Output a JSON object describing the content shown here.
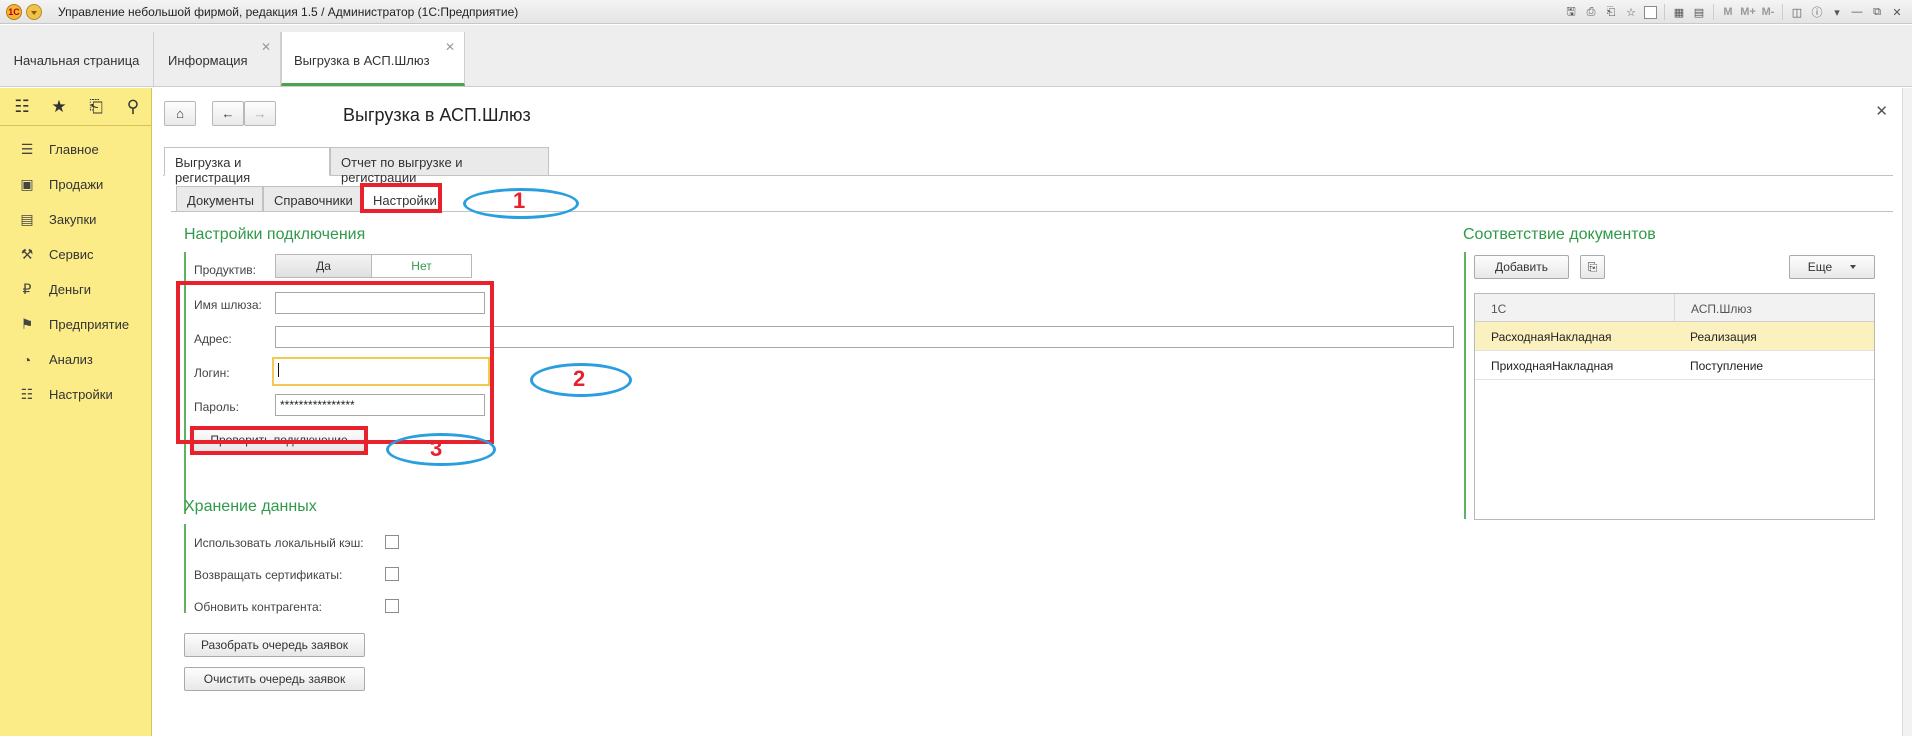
{
  "window": {
    "title": "Управление небольшой фирмой, редакция 1.5 / Администратор  (1С:Предприятие)",
    "logo_text": "1С",
    "toolbar_m_labels": [
      "M",
      "M+",
      "M-"
    ]
  },
  "open_tabs": [
    {
      "label": "Начальная страница",
      "closable": false,
      "active": false
    },
    {
      "label": "Информация",
      "closable": true,
      "active": false
    },
    {
      "label": "Выгрузка в АСП.Шлюз",
      "closable": true,
      "active": true
    }
  ],
  "sidebar": {
    "top_icons": [
      "apps-grid-icon",
      "star-icon",
      "history-icon",
      "search-icon"
    ],
    "items": [
      {
        "label": "Главное",
        "icon": "menu-lines-icon"
      },
      {
        "label": "Продажи",
        "icon": "basket-icon"
      },
      {
        "label": "Закупки",
        "icon": "cart-icon"
      },
      {
        "label": "Сервис",
        "icon": "tools-icon"
      },
      {
        "label": "Деньги",
        "icon": "coin-icon"
      },
      {
        "label": "Предприятие",
        "icon": "flag-icon"
      },
      {
        "label": "Анализ",
        "icon": "pie-chart-icon"
      },
      {
        "label": "Настройки",
        "icon": "settings-list-icon"
      }
    ]
  },
  "form": {
    "title": "Выгрузка в АСП.Шлюз",
    "tabs": [
      "Выгрузка и регистрация",
      "Отчет по выгрузке и регистрации"
    ],
    "subtabs": [
      "Документы",
      "Справочники",
      "Настройки"
    ],
    "connection": {
      "section_title": "Настройки подключения",
      "productive_label": "Продуктив:",
      "productive_options": [
        "Да",
        "Нет"
      ],
      "productive_value": "Нет",
      "gateway_name_label": "Имя шлюза:",
      "gateway_name_value": "",
      "address_label": "Адрес:",
      "address_value": "",
      "login_label": "Логин:",
      "login_value": "",
      "password_label": "Пароль:",
      "password_value": "****************",
      "check_button": "Проверить подключение"
    },
    "storage": {
      "section_title": "Хранение данных",
      "options": [
        {
          "label": "Использовать локальный кэш:",
          "checked": false
        },
        {
          "label": "Возвращать сертификаты:",
          "checked": false
        },
        {
          "label": "Обновить контрагента:",
          "checked": false
        }
      ]
    },
    "queue_buttons": [
      "Разобрать очередь заявок",
      "Очистить очередь заявок"
    ],
    "documents_map": {
      "section_title": "Соответствие документов",
      "add_button": "Добавить",
      "more_button": "Еще",
      "columns": [
        "1С",
        "АСП.Шлюз"
      ],
      "rows": [
        [
          "РасходнаяНакладная",
          "Реализация"
        ],
        [
          "ПриходнаяНакладная",
          "Поступление"
        ]
      ],
      "selected_row": 0
    }
  },
  "annotations": {
    "numbers": [
      "1",
      "2",
      "3"
    ],
    "highlight_color": "#e8212d",
    "ellipse_color": "#2a9fe0"
  },
  "colors": {
    "accent_green": "#2f9a49",
    "sidebar_yellow": "#fbec88",
    "selected_row": "#fbf1be"
  }
}
